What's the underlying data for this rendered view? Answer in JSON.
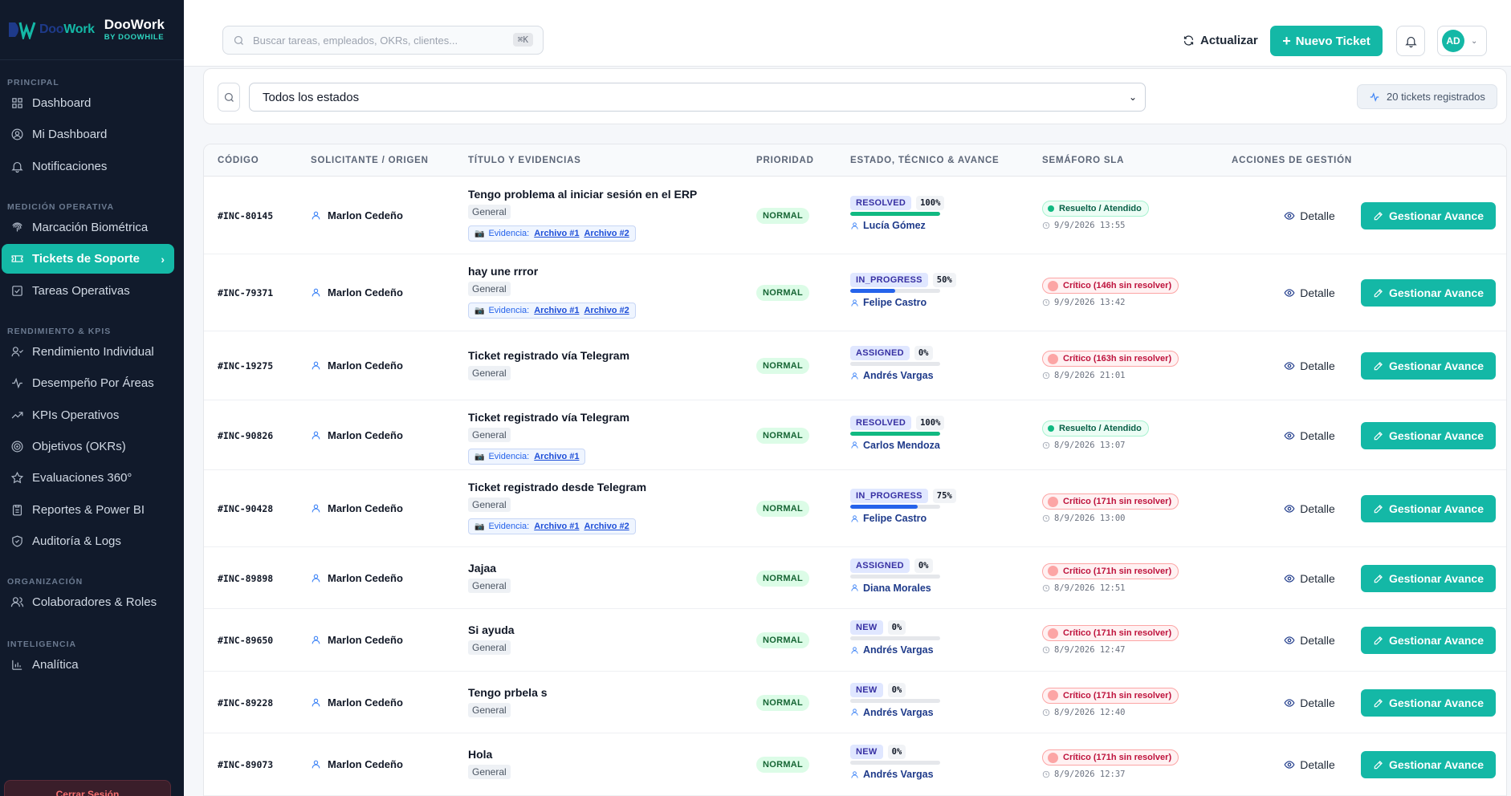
{
  "brand": {
    "logo_prefix": "Doo",
    "logo_suffix": "Work",
    "title": "DooWork",
    "subtitle": "BY DOOWHILE"
  },
  "sidebar": {
    "sections": [
      {
        "label": "PRINCIPAL",
        "items": [
          {
            "label": "Dashboard",
            "icon": "grid-icon"
          },
          {
            "label": "Mi Dashboard",
            "icon": "user-circle-icon"
          },
          {
            "label": "Notificaciones",
            "icon": "bell-icon"
          }
        ]
      },
      {
        "label": "MEDICIÓN OPERATIVA",
        "items": [
          {
            "label": "Marcación Biométrica",
            "icon": "fingerprint-icon"
          },
          {
            "label": "Tickets de Soporte",
            "icon": "ticket-icon",
            "active": true
          },
          {
            "label": "Tareas Operativas",
            "icon": "checkbox-icon"
          }
        ]
      },
      {
        "label": "RENDIMIENTO & KPIS",
        "items": [
          {
            "label": "Rendimiento Individual",
            "icon": "user-check-icon"
          },
          {
            "label": "Desempeño Por Áreas",
            "icon": "activity-icon"
          },
          {
            "label": "KPIs Operativos",
            "icon": "trending-up-icon"
          },
          {
            "label": "Objetivos (OKRs)",
            "icon": "target-icon"
          },
          {
            "label": "Evaluaciones 360°",
            "icon": "star-icon"
          },
          {
            "label": "Reportes & Power BI",
            "icon": "clipboard-icon"
          },
          {
            "label": "Auditoría & Logs",
            "icon": "shield-check-icon"
          }
        ]
      },
      {
        "label": "ORGANIZACIÓN",
        "items": [
          {
            "label": "Colaboradores & Roles",
            "icon": "users-icon"
          }
        ]
      },
      {
        "label": "INTELIGENCIA",
        "items": [
          {
            "label": "Analítica",
            "icon": "bar-chart-icon"
          }
        ]
      }
    ],
    "logout_label": "Cerrar Sesión"
  },
  "topbar": {
    "search_placeholder": "Buscar tareas, empleados, OKRs, clientes...",
    "search_shortcut": "⌘K",
    "refresh_label": "Actualizar",
    "new_ticket_label": "Nuevo Ticket",
    "avatar_initials": "AD"
  },
  "filter": {
    "status_selected": "Todos los estados",
    "count_label": "20 tickets registrados"
  },
  "table": {
    "headers": [
      "CÓDIGO",
      "SOLICITANTE / ORIGEN",
      "TÍTULO Y EVIDENCIAS",
      "PRIORIDAD",
      "ESTADO, TÉCNICO & AVANCE",
      "SEMÁFORO SLA",
      "ACCIONES DE GESTIÓN"
    ],
    "evidence_label": "Evidencia:",
    "detail_label": "Detalle",
    "manage_label": "Gestionar Avance",
    "rows": [
      {
        "code": "#INC-80145",
        "requester": "Marlon Cedeño",
        "title": "Tengo problema al iniciar sesión en el ERP",
        "category": "General",
        "evidence": [
          "Archivo #1",
          "Archivo #2"
        ],
        "priority": "NORMAL",
        "status": "RESOLVED",
        "progress": 100,
        "progress_label": "100%",
        "technician": "Lucía Gómez",
        "sla": "Resuelto / Atendido",
        "sla_level": "ok",
        "sla_time": "9/9/2026 13:55"
      },
      {
        "code": "#INC-79371",
        "requester": "Marlon Cedeño",
        "title": "hay une rrror",
        "category": "General",
        "evidence": [
          "Archivo #1",
          "Archivo #2"
        ],
        "priority": "NORMAL",
        "status": "IN_PROGRESS",
        "progress": 50,
        "progress_label": "50%",
        "technician": "Felipe Castro",
        "sla": "Crítico (146h sin resolver)",
        "sla_level": "critical",
        "sla_time": "9/9/2026 13:42"
      },
      {
        "code": "#INC-19275",
        "requester": "Marlon Cedeño",
        "title": "Ticket registrado vía Telegram",
        "category": "General",
        "evidence": [],
        "priority": "NORMAL",
        "status": "ASSIGNED",
        "progress": 0,
        "progress_label": "0%",
        "technician": "Andrés Vargas",
        "sla": "Crítico (163h sin resolver)",
        "sla_level": "critical",
        "sla_time": "8/9/2026 21:01"
      },
      {
        "code": "#INC-90826",
        "requester": "Marlon Cedeño",
        "title": "Ticket registrado vía Telegram",
        "category": "General",
        "evidence": [
          "Archivo #1"
        ],
        "priority": "NORMAL",
        "status": "RESOLVED",
        "progress": 100,
        "progress_label": "100%",
        "technician": "Carlos Mendoza",
        "sla": "Resuelto / Atendido",
        "sla_level": "ok",
        "sla_time": "8/9/2026 13:07"
      },
      {
        "code": "#INC-90428",
        "requester": "Marlon Cedeño",
        "title": "Ticket registrado desde Telegram",
        "category": "General",
        "evidence": [
          "Archivo #1",
          "Archivo #2"
        ],
        "priority": "NORMAL",
        "status": "IN_PROGRESS",
        "progress": 75,
        "progress_label": "75%",
        "technician": "Felipe Castro",
        "sla": "Crítico (171h sin resolver)",
        "sla_level": "critical",
        "sla_time": "8/9/2026 13:00"
      },
      {
        "code": "#INC-89898",
        "requester": "Marlon Cedeño",
        "title": "Jajaa",
        "category": "General",
        "evidence": [],
        "priority": "NORMAL",
        "status": "ASSIGNED",
        "progress": 0,
        "progress_label": "0%",
        "technician": "Diana Morales",
        "sla": "Crítico (171h sin resolver)",
        "sla_level": "critical",
        "sla_time": "8/9/2026 12:51"
      },
      {
        "code": "#INC-89650",
        "requester": "Marlon Cedeño",
        "title": "Si ayuda",
        "category": "General",
        "evidence": [],
        "priority": "NORMAL",
        "status": "NEW",
        "progress": 0,
        "progress_label": "0%",
        "technician": "Andrés Vargas",
        "sla": "Crítico (171h sin resolver)",
        "sla_level": "critical",
        "sla_time": "8/9/2026 12:47"
      },
      {
        "code": "#INC-89228",
        "requester": "Marlon Cedeño",
        "title": "Tengo prbela s",
        "category": "General",
        "evidence": [],
        "priority": "NORMAL",
        "status": "NEW",
        "progress": 0,
        "progress_label": "0%",
        "technician": "Andrés Vargas",
        "sla": "Crítico (171h sin resolver)",
        "sla_level": "critical",
        "sla_time": "8/9/2026 12:40"
      },
      {
        "code": "#INC-89073",
        "requester": "Marlon Cedeño",
        "title": "Hola",
        "category": "General",
        "evidence": [],
        "priority": "NORMAL",
        "status": "NEW",
        "progress": 0,
        "progress_label": "0%",
        "technician": "Andrés Vargas",
        "sla": "Crítico (171h sin resolver)",
        "sla_level": "critical",
        "sla_time": "8/9/2026 12:37"
      }
    ]
  },
  "colors": {
    "accent": "#14b8a6",
    "sidebar_bg": "#111a2b",
    "progress_done": "#10b981",
    "progress_active": "#2563eb"
  }
}
